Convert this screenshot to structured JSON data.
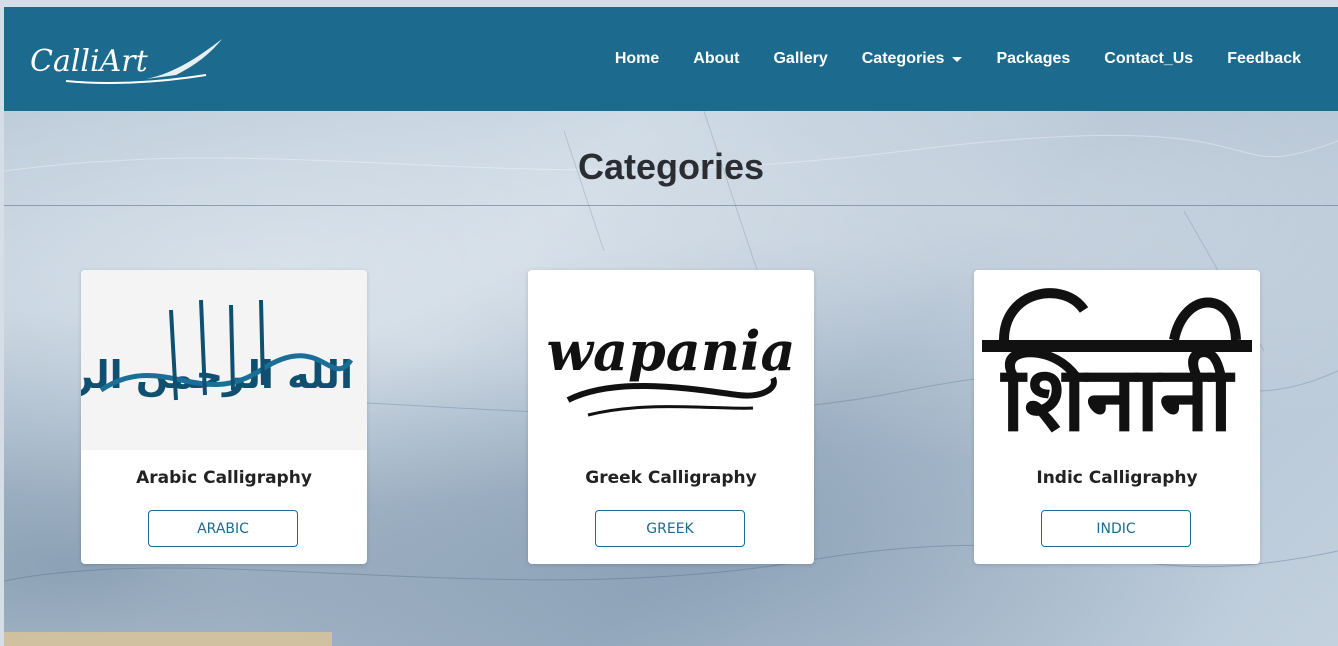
{
  "brand": {
    "logo_text": "CalliArt"
  },
  "nav": {
    "items": [
      {
        "label": "Home"
      },
      {
        "label": "About"
      },
      {
        "label": "Gallery"
      },
      {
        "label": "Categories"
      },
      {
        "label": "Packages"
      },
      {
        "label": "Contact_Us"
      },
      {
        "label": "Feedback"
      }
    ]
  },
  "page": {
    "title": "Categories"
  },
  "cards": [
    {
      "title": "Arabic Calligraphy",
      "button": "ARABIC",
      "image_text": "بسم الله الرحمن الرحيم"
    },
    {
      "title": "Greek Calligraphy",
      "button": "GREEK",
      "image_text": "wapania"
    },
    {
      "title": "Indic Calligraphy",
      "button": "INDIC",
      "image_text": "शिनानी"
    }
  ],
  "colors": {
    "navbar": "#1d6a8f",
    "button_border": "#1d6a8f"
  }
}
